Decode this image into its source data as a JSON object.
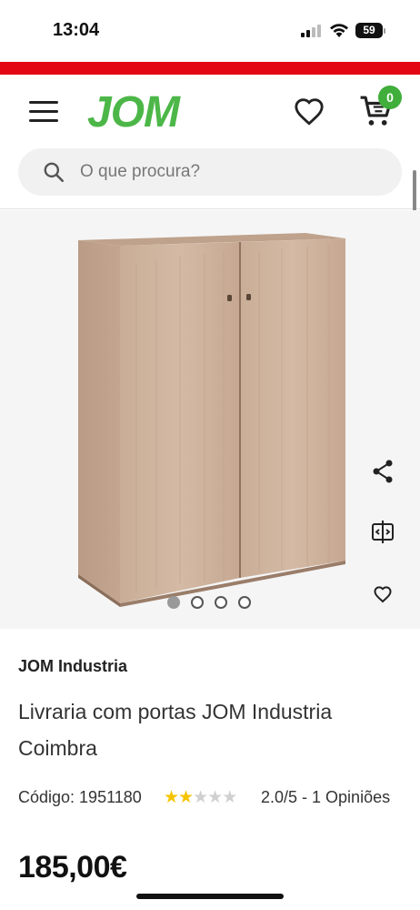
{
  "status_bar": {
    "time": "13:04",
    "battery": "59"
  },
  "header": {
    "logo": "JOM",
    "cart_count": "0",
    "search": {
      "placeholder": "O que procura?"
    }
  },
  "gallery": {
    "image_count": 4,
    "active_index": 0,
    "image_desc_icon": "wooden-cabinet-image"
  },
  "product": {
    "brand": "JOM Industria",
    "title": "Livraria com portas JOM Industria Coimbra",
    "code_label": "Código: 1951180",
    "rating_value": 2.0,
    "rating_max": 5,
    "rating_text": "2.0/5 - 1 Opiniões",
    "price": "185,00€"
  },
  "colors": {
    "brand_green": "#4cb748",
    "badge_green": "#3fae3a",
    "promo_red": "#e30613",
    "star_yellow": "#f5c400"
  }
}
